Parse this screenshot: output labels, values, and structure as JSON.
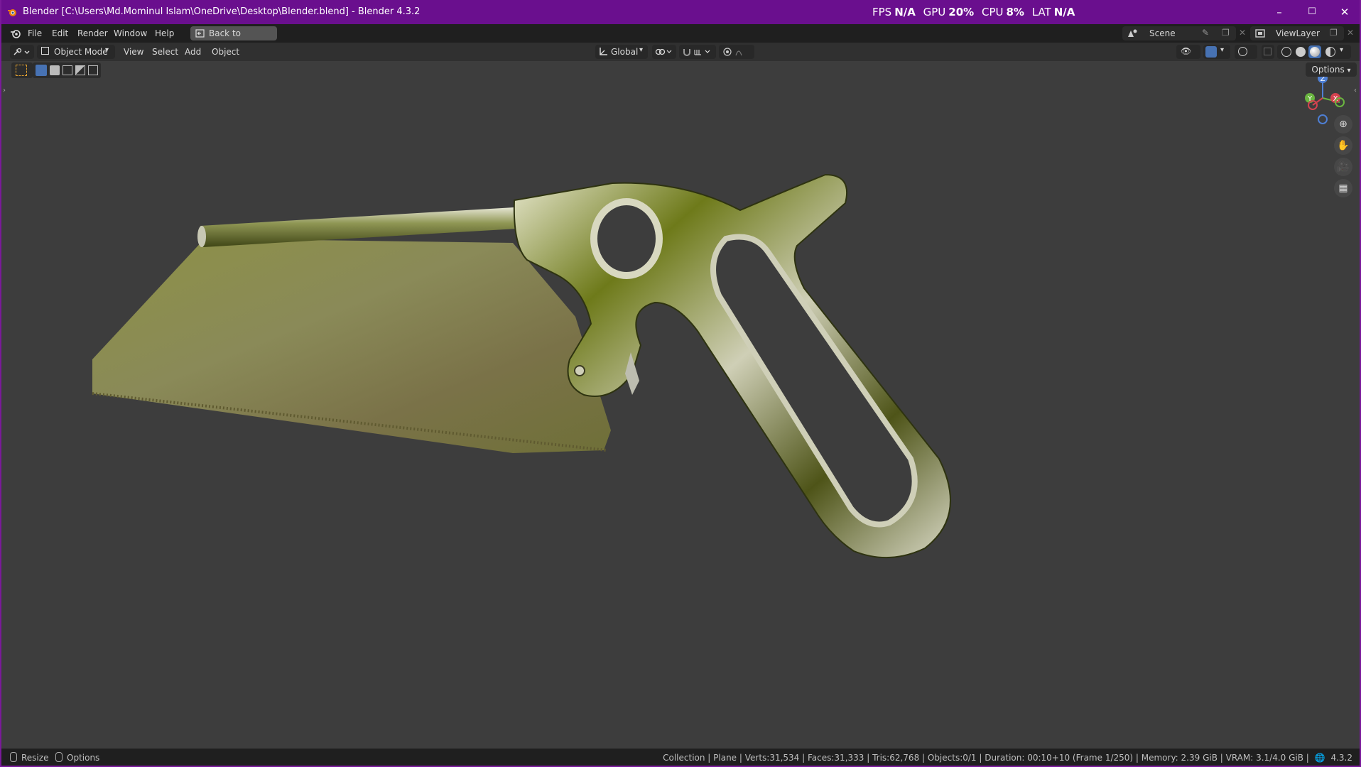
{
  "window": {
    "title": "Blender [C:\\Users\\Md.Mominul Islam\\OneDrive\\Desktop\\Blender.blend] - Blender 4.3.2",
    "accent_color": "#6a0f8e",
    "controls": {
      "minimize": "–",
      "maximize": "☐",
      "close": "✕"
    }
  },
  "perf": {
    "fps_label": "FPS",
    "fps_value": "N/A",
    "gpu_label": "GPU",
    "gpu_value": "20%",
    "cpu_label": "CPU",
    "cpu_value": "8%",
    "lat_label": "LAT",
    "lat_value": "N/A"
  },
  "menubar": {
    "items": [
      "File",
      "Edit",
      "Render",
      "Window",
      "Help"
    ],
    "back_button": "Back to Previous",
    "scene": "Scene",
    "view_layer": "ViewLayer"
  },
  "header": {
    "mode": "Object Mode",
    "menus": [
      "View",
      "Select",
      "Add",
      "Object"
    ],
    "transform_orientation": "Global"
  },
  "viewport": {
    "options_label": "Options",
    "axes": {
      "z": "Z",
      "y": "Y",
      "x": "X"
    }
  },
  "statusbar": {
    "resize": "Resize",
    "options": "Options",
    "info": "Collection | Plane | Verts:31,534 | Faces:31,333 | Tris:62,768 | Objects:0/1 | Duration: 00:10+10 (Frame 1/250) | Memory: 2.39 GiB | VRAM: 3.1/4.0 GiB |",
    "version": "4.3.2"
  }
}
